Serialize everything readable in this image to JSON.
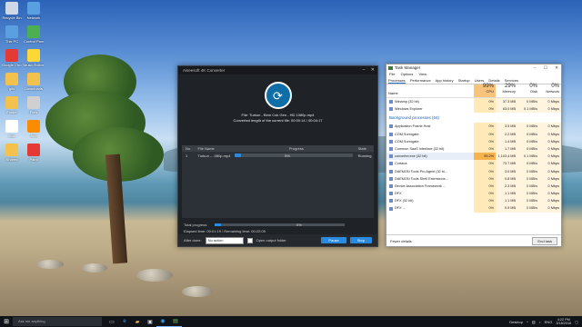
{
  "desktop": {
    "icons": [
      {
        "label": "Recycle Bin"
      },
      {
        "label": "Network"
      },
      {
        "label": "This PC"
      },
      {
        "label": "Control Panel"
      },
      {
        "label": "Google Chrome"
      },
      {
        "label": "Music Editor"
      },
      {
        "label": "gifs"
      },
      {
        "label": "Downloads"
      },
      {
        "label": "Folder"
      },
      {
        "label": "Files"
      },
      {
        "label": "Doc"
      },
      {
        "label": "App"
      },
      {
        "label": "Shared"
      },
      {
        "label": "Paint"
      }
    ]
  },
  "converter": {
    "title": "Aiseesoft 4K Converter",
    "file_line": "File: Turkun - Bem Cok Gen - HD 1080p.mp4",
    "length_line": "Converted length of the current file: 00:00:14 / 00:04:17",
    "columns": {
      "no": "No.",
      "file": "File Name",
      "progress": "Progress",
      "state": "State"
    },
    "rows": [
      {
        "no": "1",
        "file": "Turkun -...080p.mp4",
        "progress_pct": 5,
        "progress_text": "5%",
        "state": "Running"
      }
    ],
    "total_label": "Total progress:",
    "total_pct": 5,
    "total_text": "5%",
    "times": "Elapsed time: 00:01:19 / Remaining time: 00:22:05",
    "after_done_label": "After done:",
    "after_done_value": "No action",
    "open_folder_label": "Open output folder",
    "pause_label": "Pause",
    "stop_label": "Stop"
  },
  "taskmgr": {
    "title": "Task Manager",
    "menu": [
      "File",
      "Options",
      "View"
    ],
    "tabs": [
      "Processes",
      "Performance",
      "App history",
      "Startup",
      "Users",
      "Details",
      "Services"
    ],
    "headers": {
      "name": "Name",
      "cpu_pct": "99%",
      "cpu": "CPU",
      "mem_pct": "29%",
      "mem": "Memory",
      "disk_pct": "0%",
      "disk": "Disk",
      "net_pct": "0%",
      "net": "Network"
    },
    "apps": [
      {
        "name": "Winamp (32 bit)",
        "cpu": "0%",
        "mem": "37.3 MB",
        "disk": "0 MB/s",
        "net": "0 Mbps"
      },
      {
        "name": "Windows Explorer",
        "cpu": "0%",
        "mem": "63.0 MB",
        "disk": "0.1 MB/s",
        "net": "0 Mbps"
      }
    ],
    "section_label": "Background processes (64)",
    "background": [
      {
        "name": "Application Frame Host",
        "cpu": "0%",
        "mem": "3.5 MB",
        "disk": "0 MB/s",
        "net": "0 Mbps"
      },
      {
        "name": "COM Surrogate",
        "cpu": "0%",
        "mem": "2.2 MB",
        "disk": "0 MB/s",
        "net": "0 Mbps"
      },
      {
        "name": "COM Surrogate",
        "cpu": "0%",
        "mem": "1.4 MB",
        "disk": "0 MB/s",
        "net": "0 Mbps"
      },
      {
        "name": "Common SaaS Interface (32 bit)",
        "cpu": "0%",
        "mem": "1.7 MB",
        "disk": "0 MB/s",
        "net": "0 Mbps"
      },
      {
        "name": "converter.exe (32 bit)",
        "cpu": "95.2%",
        "mem": "1,103.4 MB",
        "disk": "0.1 MB/s",
        "net": "0 Mbps",
        "hi": true
      },
      {
        "name": "Cortana",
        "cpu": "0%",
        "mem": "73.7 MB",
        "disk": "0 MB/s",
        "net": "0 Mbps"
      },
      {
        "name": "DAEMON Tools Pro Agent (32 bi...",
        "cpu": "0%",
        "mem": "3.0 MB",
        "disk": "0 MB/s",
        "net": "0 Mbps"
      },
      {
        "name": "DAEMON Tools Shell Extensions...",
        "cpu": "0%",
        "mem": "0.8 MB",
        "disk": "0 MB/s",
        "net": "0 Mbps"
      },
      {
        "name": "Device Association Framework ...",
        "cpu": "0%",
        "mem": "2.3 MB",
        "disk": "0 MB/s",
        "net": "0 Mbps"
      },
      {
        "name": "DFX",
        "cpu": "0%",
        "mem": "1.1 MB",
        "disk": "0 MB/s",
        "net": "0 Mbps"
      },
      {
        "name": "DFX (32 bit)",
        "cpu": "0%",
        "mem": "1.1 MB",
        "disk": "0 MB/s",
        "net": "0 Mbps"
      },
      {
        "name": "DFX ...",
        "cpu": "0%",
        "mem": "0.9 MB",
        "disk": "0 MB/s",
        "net": "0 Mbps"
      }
    ],
    "fewer_details": "Fewer details",
    "end_task": "End task"
  },
  "taskbar": {
    "search_placeholder": "Ask me anything",
    "desktop_label": "Desktop",
    "lang": "ENG",
    "time": "4:22 PM",
    "date": "3/18/2016"
  }
}
